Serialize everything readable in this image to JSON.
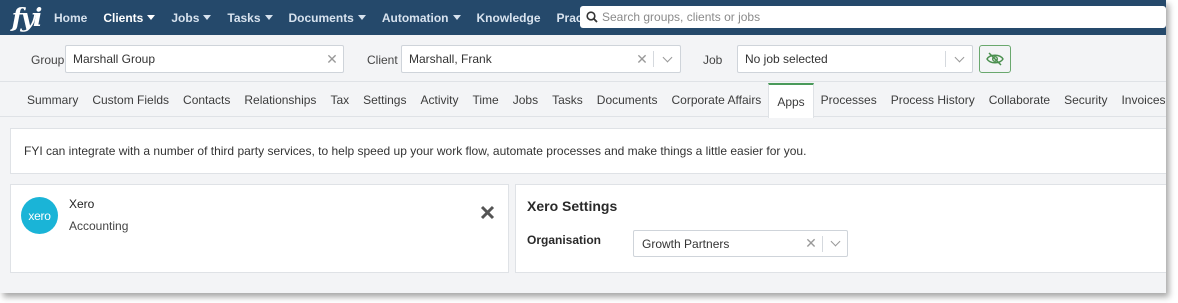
{
  "app": {
    "logo_text": "fyi"
  },
  "nav": {
    "items": [
      {
        "label": "Home",
        "has_caret": false,
        "active": false
      },
      {
        "label": "Clients",
        "has_caret": true,
        "active": true
      },
      {
        "label": "Jobs",
        "has_caret": true,
        "active": false
      },
      {
        "label": "Tasks",
        "has_caret": true,
        "active": false
      },
      {
        "label": "Documents",
        "has_caret": true,
        "active": false
      },
      {
        "label": "Automation",
        "has_caret": true,
        "active": false
      },
      {
        "label": "Knowledge",
        "has_caret": false,
        "active": false
      },
      {
        "label": "Practice",
        "has_caret": false,
        "active": false
      }
    ],
    "search_placeholder": "Search groups, clients or jobs"
  },
  "selectors": {
    "group_label": "Group",
    "group_value": "Marshall Group",
    "client_label": "Client",
    "client_value": "Marshall, Frank",
    "job_label": "Job",
    "job_value": "No job selected"
  },
  "tabs": [
    {
      "label": "Summary",
      "active": false
    },
    {
      "label": "Custom Fields",
      "active": false
    },
    {
      "label": "Contacts",
      "active": false
    },
    {
      "label": "Relationships",
      "active": false
    },
    {
      "label": "Tax",
      "active": false
    },
    {
      "label": "Settings",
      "active": false
    },
    {
      "label": "Activity",
      "active": false
    },
    {
      "label": "Time",
      "active": false
    },
    {
      "label": "Jobs",
      "active": false
    },
    {
      "label": "Tasks",
      "active": false
    },
    {
      "label": "Documents",
      "active": false
    },
    {
      "label": "Corporate Affairs",
      "active": false
    },
    {
      "label": "Apps",
      "active": true
    },
    {
      "label": "Processes",
      "active": false
    },
    {
      "label": "Process History",
      "active": false
    },
    {
      "label": "Collaborate",
      "active": false
    },
    {
      "label": "Security",
      "active": false
    },
    {
      "label": "Invoices",
      "active": false
    }
  ],
  "banner": {
    "text": "FYI can integrate with a number of third party services, to help speed up your work flow, automate processes and make things a little easier for you."
  },
  "app_card": {
    "logo_text": "xero",
    "name": "Xero",
    "category": "Accounting"
  },
  "settings": {
    "title": "Xero Settings",
    "organisation_label": "Organisation",
    "organisation_value": "Growth Partners"
  },
  "colors": {
    "nav_bg": "#25496b",
    "active_tab_accent": "#4a9a5a",
    "xero_blue": "#1ab4d7"
  }
}
